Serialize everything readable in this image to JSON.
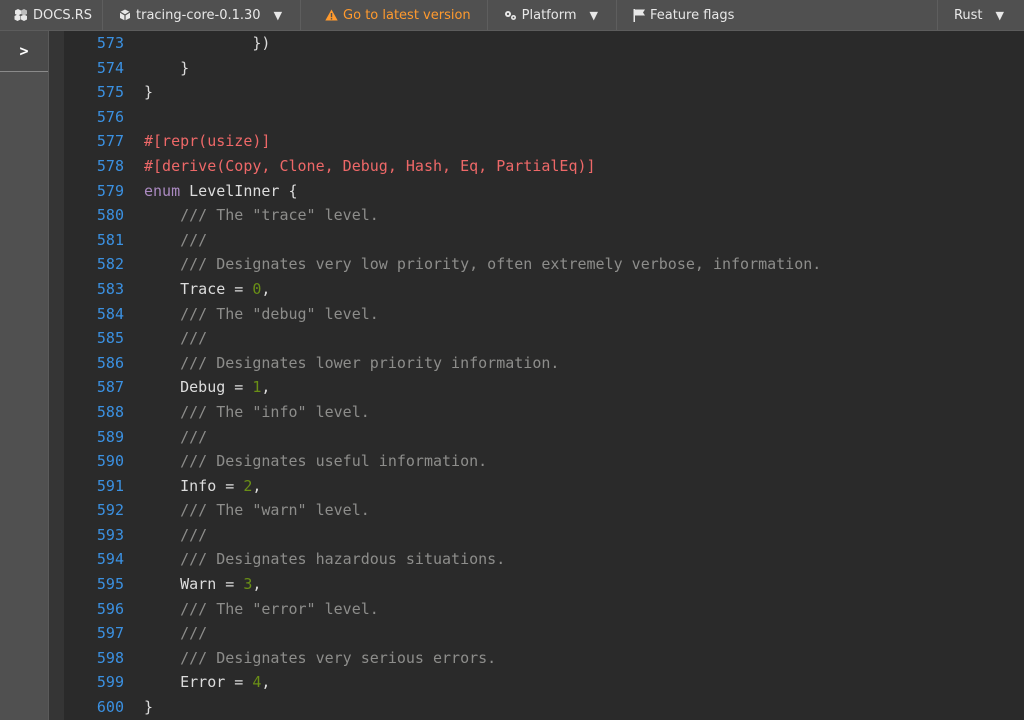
{
  "nav": {
    "logo_label": "DOCS.RS",
    "crate_label": "tracing-core-0.1.30",
    "latest_label": "Go to latest version",
    "platform_label": "Platform",
    "flags_label": "Feature flags",
    "lang_label": "Rust",
    "caret": "▼"
  },
  "sidebar": {
    "toggle_label": ">"
  },
  "colors": {
    "line_number": "#3b91e2",
    "comment": "#8d8d8b",
    "attribute": "#ee6868",
    "keyword": "#ab8ac1",
    "number": "#6a8f16",
    "warning": "#ff9a2e"
  },
  "code_lines": [
    {
      "n": "573",
      "tokens": [
        {
          "t": "            })",
          "k": "plain"
        }
      ]
    },
    {
      "n": "574",
      "tokens": [
        {
          "t": "    }",
          "k": "plain"
        }
      ]
    },
    {
      "n": "575",
      "tokens": [
        {
          "t": "}",
          "k": "plain"
        }
      ]
    },
    {
      "n": "576",
      "tokens": []
    },
    {
      "n": "577",
      "tokens": [
        {
          "t": "#[repr(usize)]",
          "k": "attr"
        }
      ]
    },
    {
      "n": "578",
      "tokens": [
        {
          "t": "#[derive(Copy, Clone, Debug, Hash, Eq, PartialEq)]",
          "k": "attr"
        }
      ]
    },
    {
      "n": "579",
      "tokens": [
        {
          "t": "enum",
          "k": "kw"
        },
        {
          "t": " LevelInner {",
          "k": "plain"
        }
      ]
    },
    {
      "n": "580",
      "tokens": [
        {
          "t": "    ",
          "k": "plain"
        },
        {
          "t": "/// The \"trace\" level.",
          "k": "comment"
        }
      ]
    },
    {
      "n": "581",
      "tokens": [
        {
          "t": "    ",
          "k": "plain"
        },
        {
          "t": "///",
          "k": "comment"
        }
      ]
    },
    {
      "n": "582",
      "tokens": [
        {
          "t": "    ",
          "k": "plain"
        },
        {
          "t": "/// Designates very low priority, often extremely verbose, information.",
          "k": "comment"
        }
      ]
    },
    {
      "n": "583",
      "tokens": [
        {
          "t": "    Trace = ",
          "k": "plain"
        },
        {
          "t": "0",
          "k": "num"
        },
        {
          "t": ",",
          "k": "plain"
        }
      ]
    },
    {
      "n": "584",
      "tokens": [
        {
          "t": "    ",
          "k": "plain"
        },
        {
          "t": "/// The \"debug\" level.",
          "k": "comment"
        }
      ]
    },
    {
      "n": "585",
      "tokens": [
        {
          "t": "    ",
          "k": "plain"
        },
        {
          "t": "///",
          "k": "comment"
        }
      ]
    },
    {
      "n": "586",
      "tokens": [
        {
          "t": "    ",
          "k": "plain"
        },
        {
          "t": "/// Designates lower priority information.",
          "k": "comment"
        }
      ]
    },
    {
      "n": "587",
      "tokens": [
        {
          "t": "    Debug = ",
          "k": "plain"
        },
        {
          "t": "1",
          "k": "num"
        },
        {
          "t": ",",
          "k": "plain"
        }
      ]
    },
    {
      "n": "588",
      "tokens": [
        {
          "t": "    ",
          "k": "plain"
        },
        {
          "t": "/// The \"info\" level.",
          "k": "comment"
        }
      ]
    },
    {
      "n": "589",
      "tokens": [
        {
          "t": "    ",
          "k": "plain"
        },
        {
          "t": "///",
          "k": "comment"
        }
      ]
    },
    {
      "n": "590",
      "tokens": [
        {
          "t": "    ",
          "k": "plain"
        },
        {
          "t": "/// Designates useful information.",
          "k": "comment"
        }
      ]
    },
    {
      "n": "591",
      "tokens": [
        {
          "t": "    Info = ",
          "k": "plain"
        },
        {
          "t": "2",
          "k": "num"
        },
        {
          "t": ",",
          "k": "plain"
        }
      ]
    },
    {
      "n": "592",
      "tokens": [
        {
          "t": "    ",
          "k": "plain"
        },
        {
          "t": "/// The \"warn\" level.",
          "k": "comment"
        }
      ]
    },
    {
      "n": "593",
      "tokens": [
        {
          "t": "    ",
          "k": "plain"
        },
        {
          "t": "///",
          "k": "comment"
        }
      ]
    },
    {
      "n": "594",
      "tokens": [
        {
          "t": "    ",
          "k": "plain"
        },
        {
          "t": "/// Designates hazardous situations.",
          "k": "comment"
        }
      ]
    },
    {
      "n": "595",
      "tokens": [
        {
          "t": "    Warn = ",
          "k": "plain"
        },
        {
          "t": "3",
          "k": "num"
        },
        {
          "t": ",",
          "k": "plain"
        }
      ]
    },
    {
      "n": "596",
      "tokens": [
        {
          "t": "    ",
          "k": "plain"
        },
        {
          "t": "/// The \"error\" level.",
          "k": "comment"
        }
      ]
    },
    {
      "n": "597",
      "tokens": [
        {
          "t": "    ",
          "k": "plain"
        },
        {
          "t": "///",
          "k": "comment"
        }
      ]
    },
    {
      "n": "598",
      "tokens": [
        {
          "t": "    ",
          "k": "plain"
        },
        {
          "t": "/// Designates very serious errors.",
          "k": "comment"
        }
      ]
    },
    {
      "n": "599",
      "tokens": [
        {
          "t": "    Error = ",
          "k": "plain"
        },
        {
          "t": "4",
          "k": "num"
        },
        {
          "t": ",",
          "k": "plain"
        }
      ]
    },
    {
      "n": "600",
      "tokens": [
        {
          "t": "}",
          "k": "plain"
        }
      ]
    }
  ]
}
